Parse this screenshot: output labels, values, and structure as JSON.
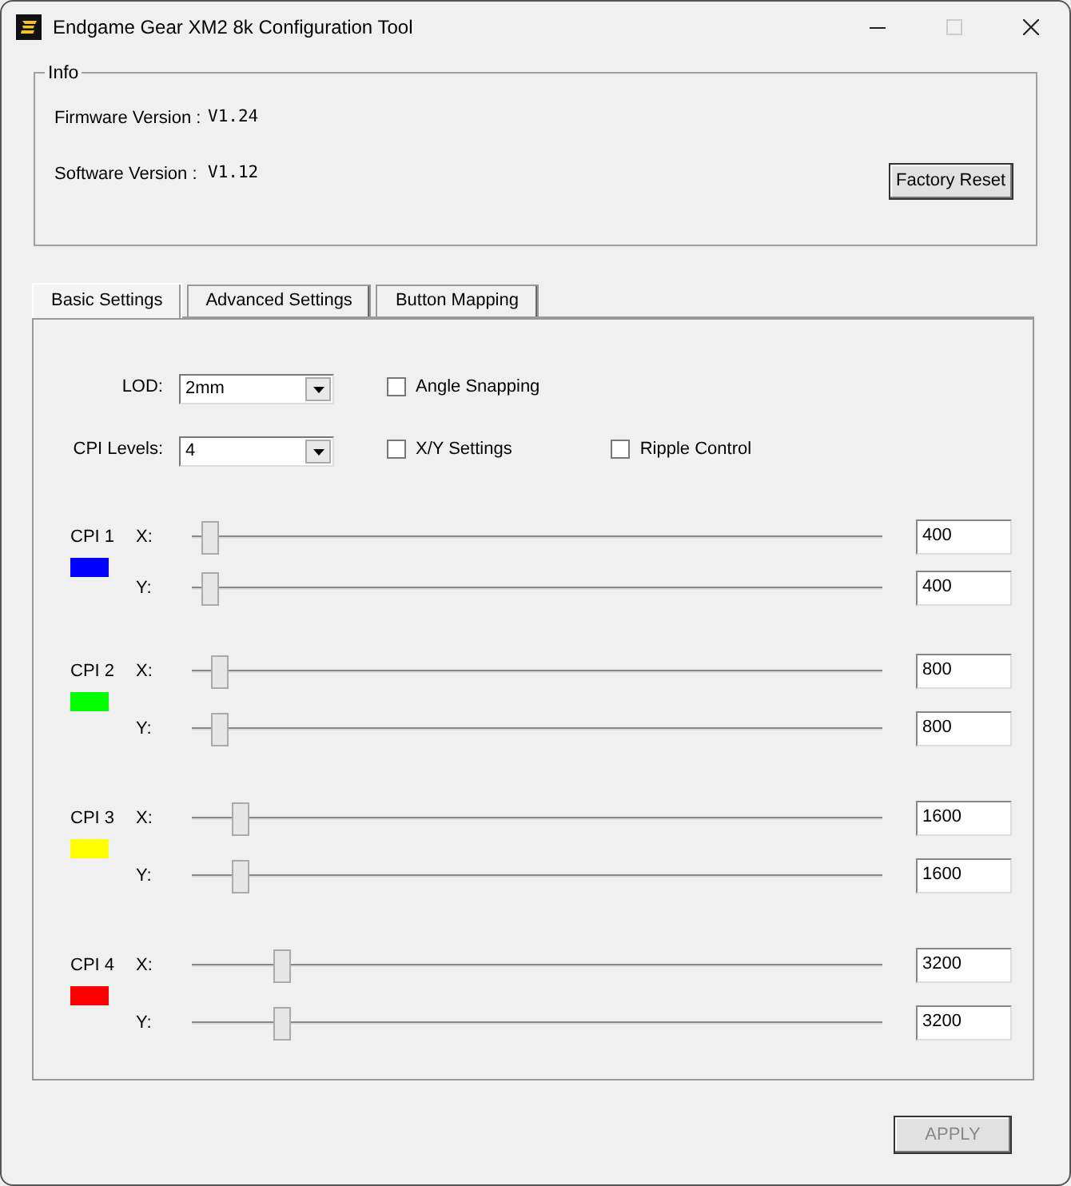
{
  "window": {
    "title": "Endgame Gear XM2 8k Configuration Tool",
    "maximize_enabled": false
  },
  "info": {
    "legend": "Info",
    "rows": [
      {
        "label": "Firmware Version :",
        "value": "V1.24"
      },
      {
        "label": "Software Version :",
        "value": "V1.12"
      }
    ],
    "reset_button": "Factory Reset"
  },
  "tabs": [
    {
      "label": "Basic Settings",
      "selected": true
    },
    {
      "label": "Advanced Settings",
      "selected": false
    },
    {
      "label": "Button Mapping",
      "selected": false
    }
  ],
  "settings": [
    {
      "label": "LOD:",
      "value": "2mm",
      "checkboxes": [
        {
          "label": "Angle Snapping",
          "checked": false
        }
      ]
    },
    {
      "label": "CPI Levels:",
      "value": "4",
      "checkboxes": [
        {
          "label": "X/Y Settings",
          "checked": false
        },
        {
          "label": "Ripple Control",
          "checked": false
        }
      ]
    }
  ],
  "cpi": [
    {
      "name": "CPI 1",
      "color": "#0000ff",
      "axes": [
        {
          "label": "X:",
          "level": 0.025,
          "value": "400"
        },
        {
          "label": "Y:",
          "level": 0.025,
          "value": "400"
        }
      ]
    },
    {
      "name": "CPI 2",
      "color": "#00ff00",
      "axes": [
        {
          "label": "X:",
          "level": 0.04,
          "value": "800"
        },
        {
          "label": "Y:",
          "level": 0.04,
          "value": "800"
        }
      ]
    },
    {
      "name": "CPI 3",
      "color": "#ffff00",
      "axes": [
        {
          "label": "X:",
          "level": 0.07,
          "value": "1600"
        },
        {
          "label": "Y:",
          "level": 0.07,
          "value": "1600"
        }
      ]
    },
    {
      "name": "CPI 4",
      "color": "#ff0000",
      "axes": [
        {
          "label": "X:",
          "level": 0.13,
          "value": "3200"
        },
        {
          "label": "Y:",
          "level": 0.13,
          "value": "3200"
        }
      ]
    }
  ],
  "apply_button": {
    "label": "APPLY",
    "disabled": true
  }
}
